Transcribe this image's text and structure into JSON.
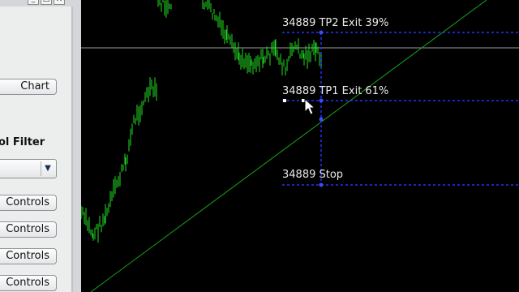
{
  "panel": {
    "window_buttons": [
      "_",
      "□",
      "X"
    ],
    "chart_button": "Chart",
    "filter_label": "ol Filter",
    "select_value": "",
    "controls_buttons": [
      "Controls",
      "Controls",
      "Controls",
      "Controls"
    ]
  },
  "chart": {
    "levels": [
      {
        "label": "34889 TP2 Exit 39%"
      },
      {
        "label": "34889 TP1 Exit 61%"
      },
      {
        "label": "34889 Stop"
      }
    ],
    "colors": {
      "background": "#000000",
      "candle": "#22dd22",
      "level_line": "#2233ff",
      "trend_line": "#1aa41a",
      "horizontal_line": "#9a9a9a"
    }
  }
}
